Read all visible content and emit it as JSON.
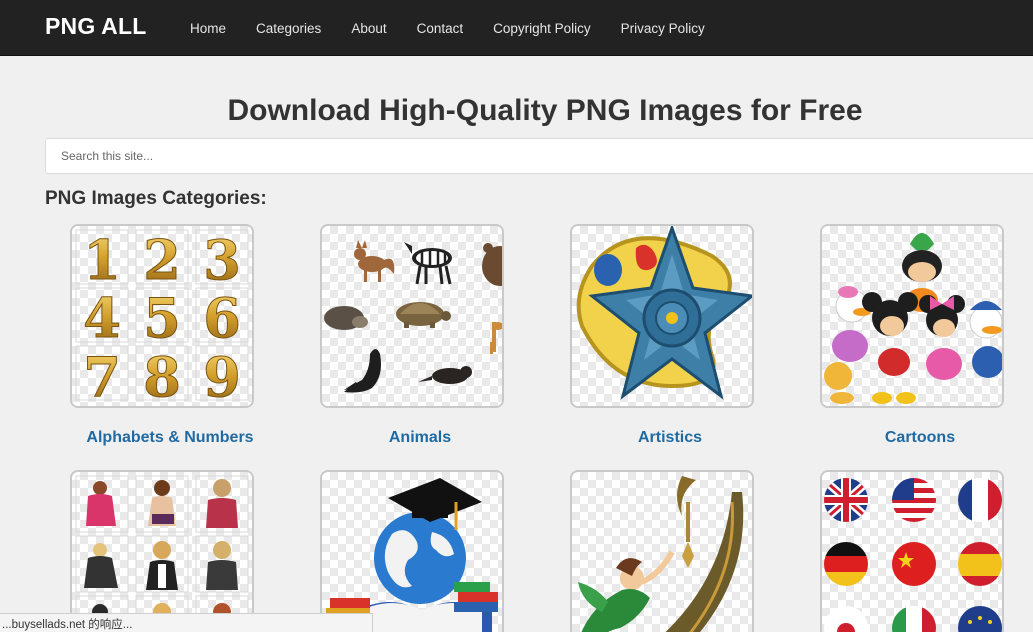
{
  "brand": "PNG ALL",
  "nav": {
    "home": "Home",
    "categories": "Categories",
    "about": "About",
    "contact": "Contact",
    "copyright": "Copyright Policy",
    "privacy": "Privacy Policy"
  },
  "headline": "Download High-Quality PNG Images for Free",
  "search": {
    "placeholder": "Search this site..."
  },
  "section_title": "PNG Images Categories:",
  "categories": [
    {
      "label": "Alphabets & Numbers",
      "icon": "gold-numbers-icon"
    },
    {
      "label": "Animals",
      "icon": "animals-icon"
    },
    {
      "label": "Artistics",
      "icon": "star-palette-icon"
    },
    {
      "label": "Cartoons",
      "icon": "cartoon-characters-icon"
    }
  ],
  "digits": [
    "1",
    "2",
    "3",
    "4",
    "5",
    "6",
    "7",
    "8",
    "9"
  ],
  "status_text": "...buysellads.net 的响应...",
  "colors": {
    "navbar": "#222222",
    "link": "#1f6aa3",
    "background": "#f0f0f0"
  }
}
